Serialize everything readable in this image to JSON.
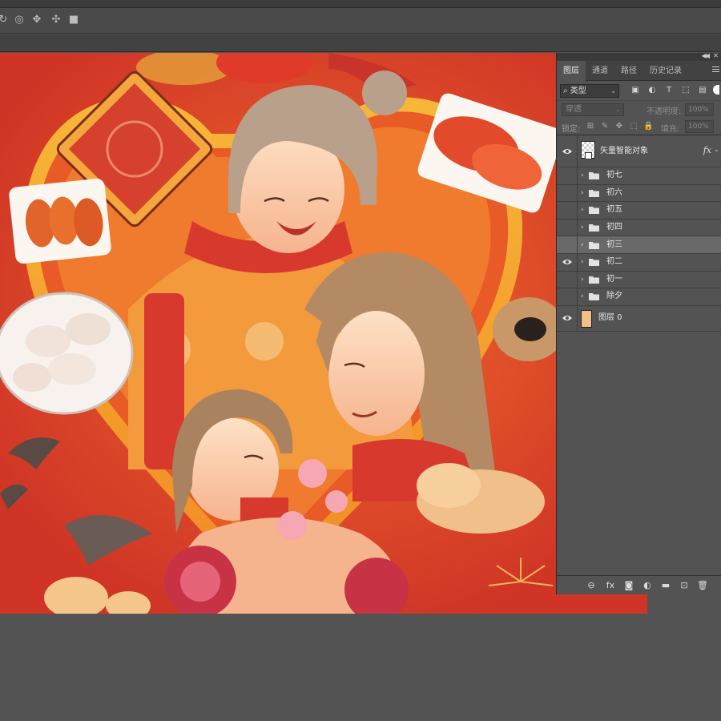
{
  "options_bar": {
    "icons": [
      "3d-orbit-icon",
      "3d-roll-icon",
      "3d-pan-icon",
      "3d-slide-icon",
      "3d-video-icon"
    ]
  },
  "panel": {
    "tabs": [
      {
        "label": "图层",
        "active": true
      },
      {
        "label": "通道",
        "active": false
      },
      {
        "label": "路径",
        "active": false
      },
      {
        "label": "历史记录",
        "active": false
      }
    ],
    "filter": {
      "label": "类型"
    },
    "blend_mode": "穿透",
    "opacity_label": "不透明度:",
    "opacity_value": "100%",
    "lock_label": "锁定:",
    "fill_label": "填充:",
    "fill_value": "100%",
    "smart_layer": {
      "name": "矢量智能对象",
      "fx": "fx"
    },
    "groups": [
      {
        "name": "初七",
        "visible": false,
        "selected": false
      },
      {
        "name": "初六",
        "visible": false,
        "selected": false
      },
      {
        "name": "初五",
        "visible": false,
        "selected": false
      },
      {
        "name": "初四",
        "visible": false,
        "selected": false
      },
      {
        "name": "初三",
        "visible": false,
        "selected": true
      },
      {
        "name": "初二",
        "visible": true,
        "selected": false
      },
      {
        "name": "初一",
        "visible": false,
        "selected": false
      },
      {
        "name": "除夕",
        "visible": false,
        "selected": false
      }
    ],
    "background_layer": {
      "name": "图层 0",
      "color": "#f3c187"
    }
  },
  "colors": {
    "canvas_red": "#d53b2a",
    "panel_bg": "#535353",
    "selected_row": "#696969"
  }
}
